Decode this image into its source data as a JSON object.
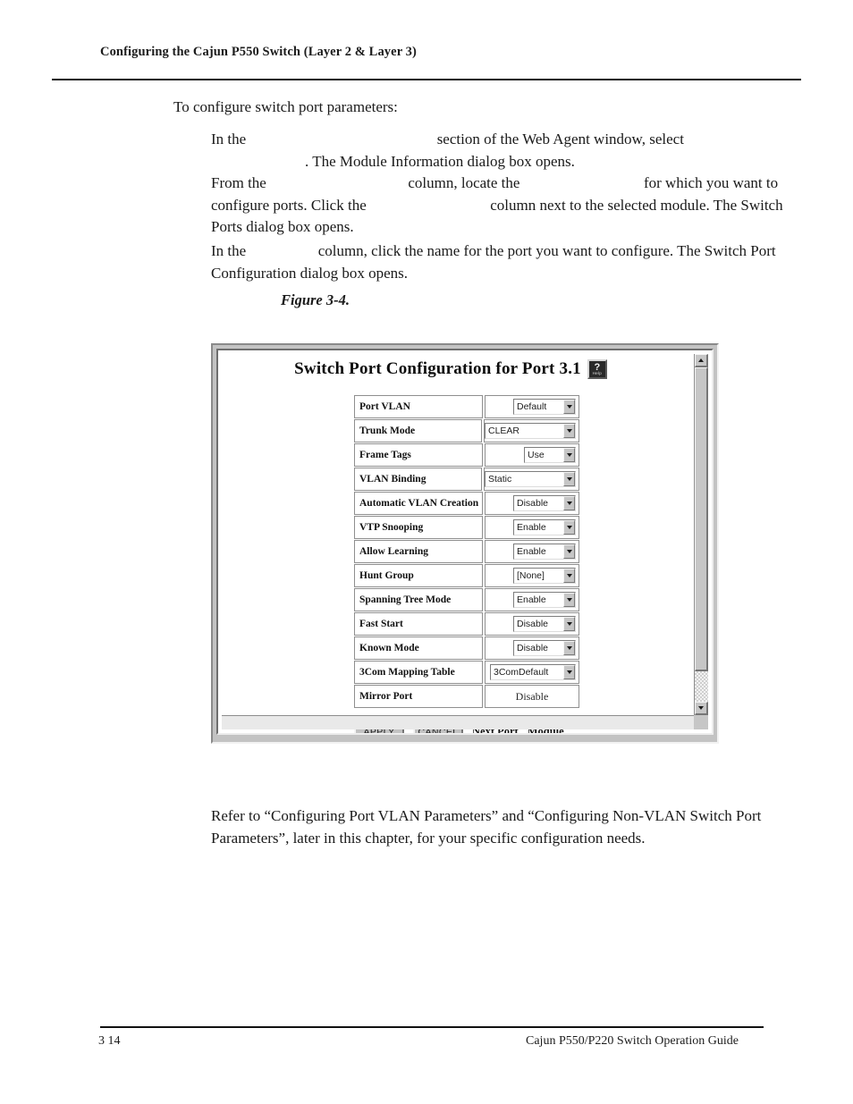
{
  "page": {
    "running_header": "Configuring the Cajun P550 Switch (Layer 2 & Layer 3)",
    "footer_page_number": "3 14",
    "footer_title": "Cajun P550/P220 Switch Operation Guide"
  },
  "body": {
    "lead": "To configure switch port parameters:",
    "step1": {
      "a": "In the",
      "b": "section of the Web Agent window, select",
      "c": ". The Module Information dialog box opens."
    },
    "step2": {
      "a": "From the",
      "b": "column, locate the",
      "c": "for which you want to configure ports. Click the",
      "d": "column next to the selected module. The Switch Ports dialog box opens."
    },
    "step3": {
      "a": "In the",
      "b": "column, click the name for the port you want to configure. The Switch Port Configuration dialog box opens."
    },
    "closing": "Refer to “Configuring Port VLAN Parameters” and “Configuring Non-VLAN Switch Port Parameters”, later in this chapter, for your specific configuration needs."
  },
  "figure": {
    "label": "Figure 3-4.",
    "caption": ""
  },
  "dialog": {
    "title": "Switch Port Configuration for Port 3.1",
    "help_glyph": "?",
    "help_word": "Help",
    "rows": [
      {
        "label": "Port VLAN",
        "value": "Default",
        "control": "select",
        "width": "sw-w70"
      },
      {
        "label": "Trunk Mode",
        "value": "CLEAR",
        "control": "select",
        "width": "sw-w102"
      },
      {
        "label": "Frame Tags",
        "value": "Use",
        "control": "select",
        "width": "sw-w58"
      },
      {
        "label": "VLAN Binding",
        "value": "Static",
        "control": "select",
        "width": "sw-w102"
      },
      {
        "label": "Automatic VLAN Creation",
        "value": "Disable",
        "control": "select",
        "width": "sw-w70"
      },
      {
        "label": "VTP Snooping",
        "value": "Enable",
        "control": "select",
        "width": "sw-w70"
      },
      {
        "label": "Allow Learning",
        "value": "Enable",
        "control": "select",
        "width": "sw-w70"
      },
      {
        "label": "Hunt Group",
        "value": "[None]",
        "control": "select",
        "width": "sw-w70"
      },
      {
        "label": "Spanning Tree Mode",
        "value": "Enable",
        "control": "select",
        "width": "sw-w70"
      },
      {
        "label": "Fast Start",
        "value": "Disable",
        "control": "select",
        "width": "sw-w70"
      },
      {
        "label": "Known Mode",
        "value": "Disable",
        "control": "select",
        "width": "sw-w70"
      },
      {
        "label": "3Com Mapping Table",
        "value": "3ComDefault",
        "control": "select",
        "width": "sw-w96"
      },
      {
        "label": "Mirror Port",
        "value": "Disable",
        "control": "text",
        "width": ""
      }
    ],
    "actions": {
      "apply": "APPLY",
      "cancel": "CANCEL",
      "next_port": "Next Port",
      "module": "Module"
    }
  },
  "colors": {
    "page_background": "#ffffff",
    "text": "#1a1a1a",
    "dialog_face": "#c3c3c3",
    "control_face": "#c6c6c6",
    "border": "#8f8f8f"
  }
}
